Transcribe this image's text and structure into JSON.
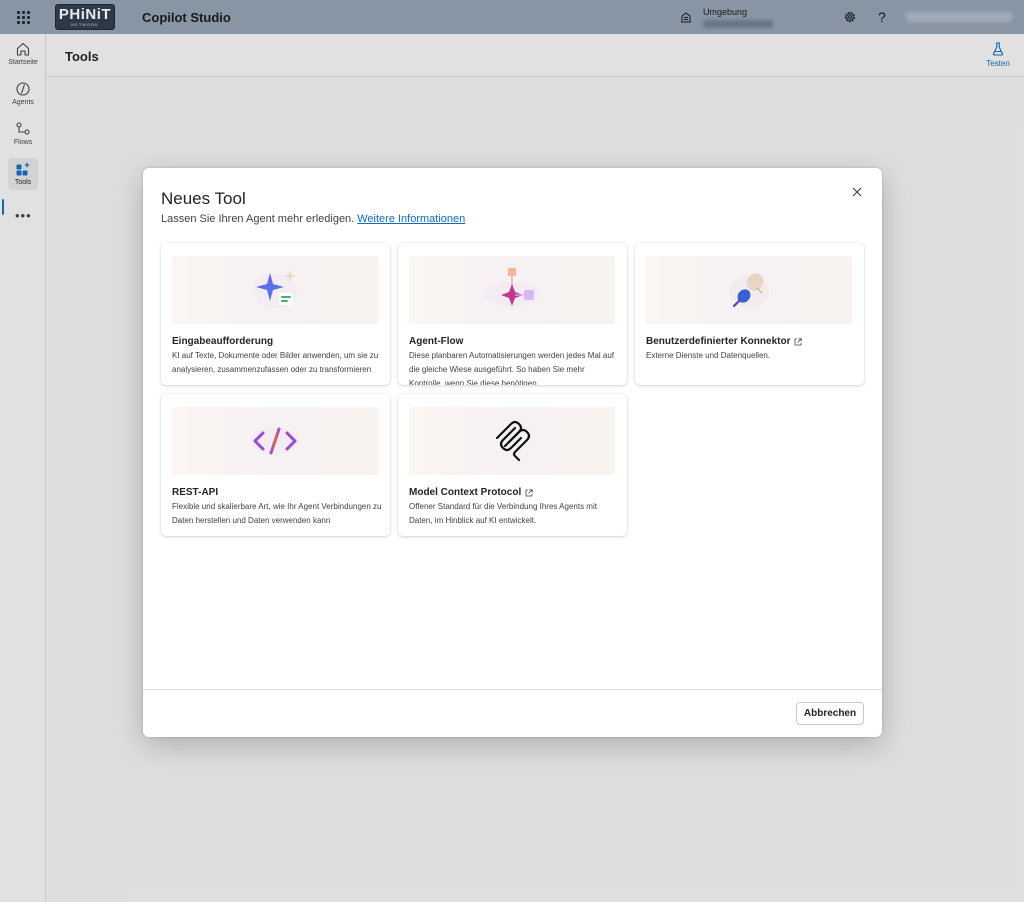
{
  "topbar": {
    "logo_text": "PHiNiT",
    "logo_subtext": "NETWORK",
    "app_title": "Copilot Studio",
    "environment_label": "Umgebung"
  },
  "rail": {
    "items": [
      {
        "label": "Startseite",
        "icon": "home-icon"
      },
      {
        "label": "Agents",
        "icon": "agents-icon"
      },
      {
        "label": "Flows",
        "icon": "flows-icon"
      },
      {
        "label": "Tools",
        "icon": "tools-icon",
        "active": true
      }
    ],
    "more_label": "•••"
  },
  "header": {
    "title": "Tools",
    "test_label": "Testen"
  },
  "dialog": {
    "title": "Neues Tool",
    "subtitle": "Lassen Sie Ihren Agent mehr erledigen.",
    "link": "Weitere Informationen",
    "cancel_label": "Abbrechen",
    "cards": [
      {
        "title": "Eingabeaufforderung",
        "description": "KI auf Texte, Dokumente oder Bilder anwenden, um sie zu analysieren, zusammenzufassen oder zu transformieren",
        "icon": "sparkle-prompt-icon",
        "external": false
      },
      {
        "title": "Agent-Flow",
        "description": "Diese planbaren Automatisierungen werden jedes Mal auf die gleiche Wiese ausgeführt. So haben Sie mehr Kontrolle, wenn Sie diese benötigen",
        "icon": "agent-flow-icon",
        "external": false
      },
      {
        "title": "Benutzerdefinierter Konnektor",
        "description": "Externe Dienste und Datenquellen.",
        "icon": "connector-plug-icon",
        "external": true
      },
      {
        "title": "REST-API",
        "description": "Flexible und skalierbare Art, wie Ihr Agent Verbindungen zu Daten herstellen und Daten verwenden kann",
        "icon": "code-icon",
        "external": false
      },
      {
        "title": "Model Context Protocol",
        "description": "Offener Standard für die Verbindung Ihres Agents mit Daten, im Hinblick auf KI entwickelt.",
        "icon": "mcp-icon",
        "external": true
      }
    ]
  },
  "colors": {
    "topbar": "#8c9aab",
    "accent": "#0f6cbd",
    "background": "#e6e6e6"
  }
}
